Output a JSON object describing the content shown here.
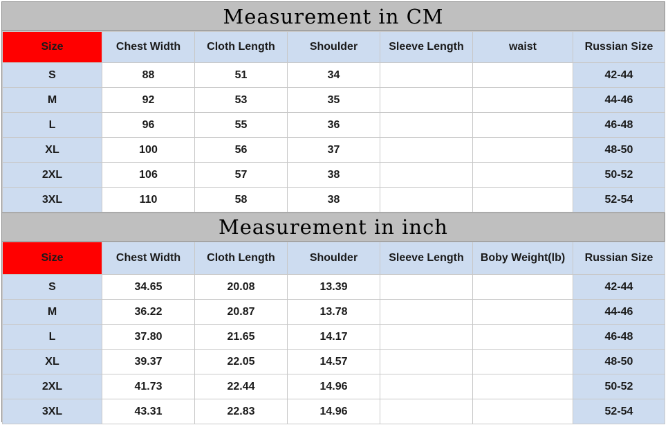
{
  "colors": {
    "title_bg": "#bfbfbf",
    "header_bg": "#cddcf0",
    "size_header_bg": "#ff0000",
    "cell_bg": "#ffffff"
  },
  "cm_table": {
    "title": "Measurement in CM",
    "headers": [
      "Size",
      "Chest Width",
      "Cloth Length",
      "Shoulder",
      "Sleeve Length",
      "waist",
      "Russian Size"
    ],
    "rows": [
      [
        "S",
        "88",
        "51",
        "34",
        "",
        "",
        "42-44"
      ],
      [
        "M",
        "92",
        "53",
        "35",
        "",
        "",
        "44-46"
      ],
      [
        "L",
        "96",
        "55",
        "36",
        "",
        "",
        "46-48"
      ],
      [
        "XL",
        "100",
        "56",
        "37",
        "",
        "",
        "48-50"
      ],
      [
        "2XL",
        "106",
        "57",
        "38",
        "",
        "",
        "50-52"
      ],
      [
        "3XL",
        "110",
        "58",
        "38",
        "",
        "",
        "52-54"
      ]
    ]
  },
  "inch_table": {
    "title": "Measurement in inch",
    "headers": [
      "Size",
      "Chest Width",
      "Cloth Length",
      "Shoulder",
      "Sleeve Length",
      "Boby Weight(lb)",
      "Russian Size"
    ],
    "rows": [
      [
        "S",
        "34.65",
        "20.08",
        "13.39",
        "",
        "",
        "42-44"
      ],
      [
        "M",
        "36.22",
        "20.87",
        "13.78",
        "",
        "",
        "44-46"
      ],
      [
        "L",
        "37.80",
        "21.65",
        "14.17",
        "",
        "",
        "46-48"
      ],
      [
        "XL",
        "39.37",
        "22.05",
        "14.57",
        "",
        "",
        "48-50"
      ],
      [
        "2XL",
        "41.73",
        "22.44",
        "14.96",
        "",
        "",
        "50-52"
      ],
      [
        "3XL",
        "43.31",
        "22.83",
        "14.96",
        "",
        "",
        "52-54"
      ]
    ]
  }
}
